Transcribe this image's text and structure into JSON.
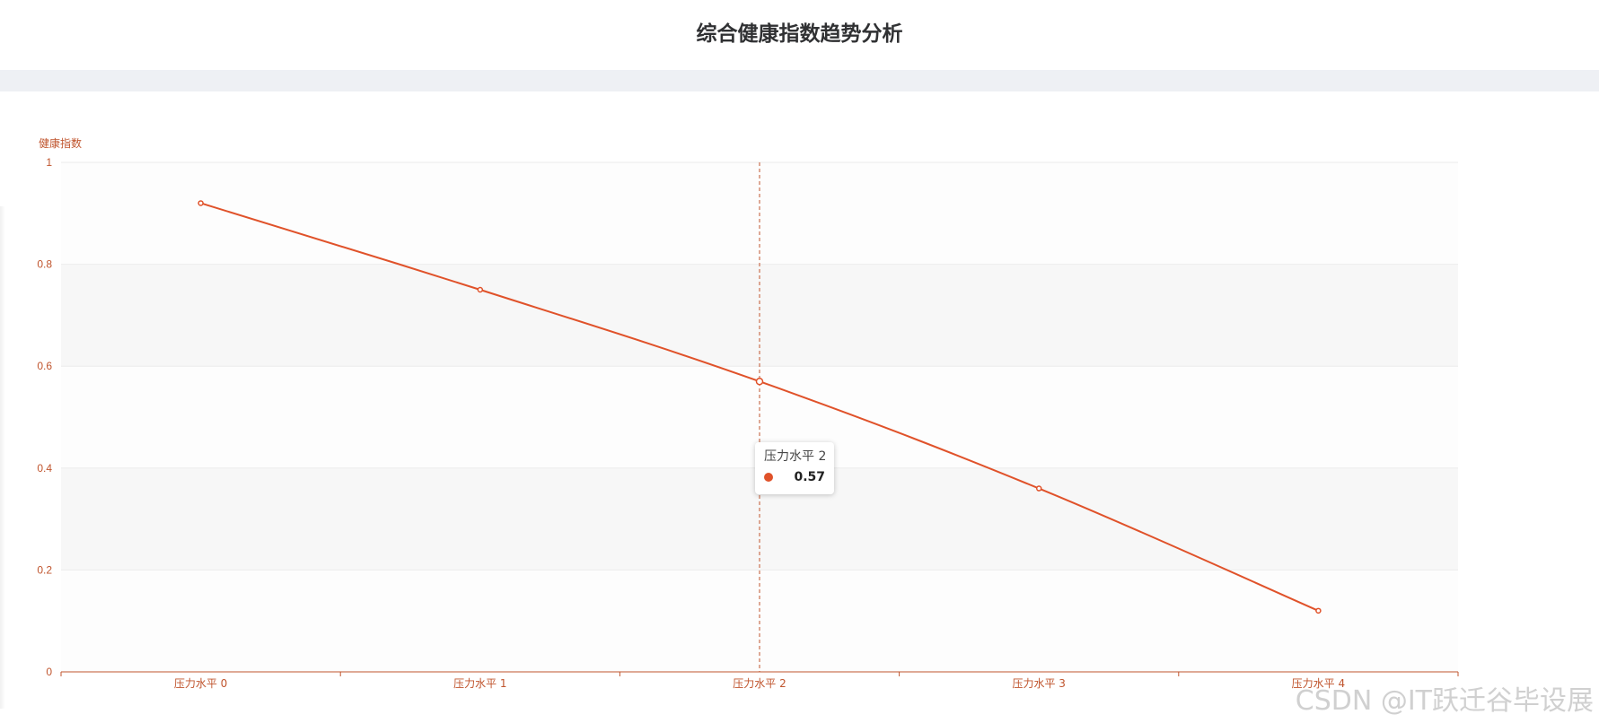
{
  "page": {
    "title": "综合健康指数趋势分析"
  },
  "colors": {
    "line": "#e0522a",
    "axis": "#c0552e",
    "label": "#c0552e",
    "band_light": "#fdfdfd",
    "band_dark": "#f7f7f7",
    "grid": "#ebebeb"
  },
  "chart_data": {
    "type": "line",
    "title": "",
    "xlabel": "",
    "ylabel": "健康指数",
    "categories": [
      "压力水平 0",
      "压力水平 1",
      "压力水平 2",
      "压力水平 3",
      "压力水平 4"
    ],
    "values": [
      0.92,
      0.75,
      0.57,
      0.36,
      0.12
    ],
    "ylim": [
      0,
      1
    ],
    "yticks": [
      "0",
      "0.2",
      "0.4",
      "0.6",
      "0.8",
      "1"
    ],
    "grid": true,
    "split_area": true,
    "smooth": true
  },
  "tooltip": {
    "title": "压力水平 2",
    "value": "0.57"
  },
  "watermark": {
    "text": "CSDN @IT跃迁谷毕设展"
  }
}
